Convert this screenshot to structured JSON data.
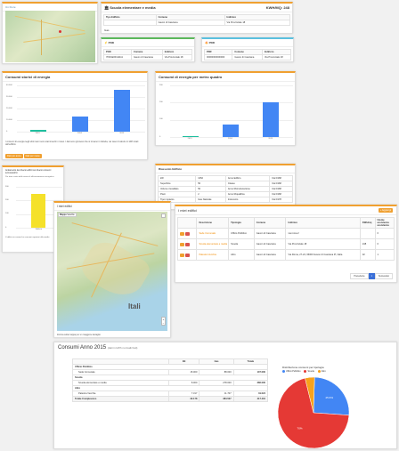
{
  "map_top": {
    "tabs": [
      "Un Fiore"
    ]
  },
  "school": {
    "title": "Scuola elementare e media",
    "kwh": "KWH/MQ: 248",
    "table_headers": [
      "Tipo Edificio",
      "Comune",
      "Indirizzo"
    ],
    "table_row": [
      "",
      "Gavon di Casciana",
      "Via Provinciale 18"
    ],
    "note": "Gas"
  },
  "pod": {
    "title": "POD",
    "headers": [
      "POD",
      "Comune",
      "Indirizzo"
    ],
    "row": [
      "IT001E00111111",
      "Gavon di Casciana",
      "Via Provinciale 18"
    ]
  },
  "pdr": {
    "title": "PDR",
    "headers": [
      "PDR",
      "Comune",
      "Indirizzo"
    ],
    "row": [
      "00000000000000",
      "Gavon di Casciana",
      "Via Provinciale 18"
    ]
  },
  "chart1": {
    "title": "Consumi storici di energia",
    "description": "I consumi di energia negli ultimi anni sono stati inseriti in rosso. I dati sono gli stessi che si trovano in bolletta, nel caso di calcolo in kWh totali dell'edificio.",
    "buttons": [
      "Dati per anno",
      "Dati per mese"
    ]
  },
  "chart2": {
    "title": "Consumi di energia per metro quadro"
  },
  "yellow_chart": {
    "title": "Andamento dei diversi edifici sui diversi consumi termoelettrici",
    "description": "Per dare conto delle azioni di efficientamento energetico.",
    "caption": "L'edificio in esame ha consumi superiori alla media"
  },
  "summary": {
    "title": "Riassunto Edificio",
    "rows": [
      [
        "kW",
        "1352",
        "Anno Edifico",
        "Dal 1968"
      ],
      [
        "Superficie",
        "50",
        "Classe",
        "Dal 1968"
      ],
      [
        "Volume riscaldato",
        "50",
        "Anno Ristrutturazione",
        "Dal 1968"
      ],
      [
        "Piani",
        "2",
        "Anno Riqualifica",
        "Dal 1968"
      ],
      [
        "Tipo impianto",
        "Gas Naturale",
        "Intervento",
        "Dal 1978"
      ]
    ]
  },
  "miei_map": {
    "title": "I miei edifici",
    "map_buttons": [
      "Mappa",
      "Satellite"
    ],
    "country_label": "Itali",
    "footer": "Zooma sulla mappa per un maggiore dettaglio"
  },
  "buildings": {
    "title": "I miei edifici",
    "add_button": "+ Aggiungi",
    "headers": [
      "",
      "Descrizione",
      "Tipologia",
      "Comune",
      "Indirizzo",
      "KWh/mq",
      "Utente assistenza assistenza"
    ],
    "rows": [
      [
        "Sede Comunale",
        "Ufficio Pubblico",
        "Gavon di Casciana",
        "via roma 2",
        "",
        "0"
      ],
      [
        "Scuola elementare e media",
        "Scuola",
        "Gavon di Casciana",
        "Via Provinciale 18",
        "248",
        "0"
      ],
      [
        "Palestra Vecchia",
        "Altro",
        "Gavon di Casciana",
        "Via Roma, 27-24, 66000 Gavon di Casciana PI, Italia",
        "32",
        "1"
      ]
    ],
    "pagination": [
      "Precedente",
      "1",
      "Successivo"
    ]
  },
  "consumi": {
    "title": "Consumi Anno 2015",
    "subtitle": "(dati in kWh normalizzati)",
    "headers": [
      "",
      "EE",
      "Gas",
      "Totale"
    ],
    "groups": [
      {
        "name": "Ufficio Pubblico",
        "rows": [
          [
            "Sede Comunale",
            "15.000",
            "88.000",
            "107.000"
          ]
        ]
      },
      {
        "name": "Scuola",
        "rows": [
          [
            "Scuola elementare e media",
            "8.000",
            "278.000",
            "286.000"
          ]
        ]
      },
      {
        "name": "Altro",
        "rows": [
          [
            "Palestra Vecchia",
            "7.317",
            "11.707",
            "19.024"
          ]
        ]
      }
    ],
    "total": [
      "Totale Complessivo",
      "22.178",
      "384.527",
      "417.410"
    ]
  },
  "pie": {
    "title": "Distribuzione consumi per tipologia",
    "legend": [
      "Ufficio Pubblico",
      "Scuola",
      "Altro"
    ],
    "colors": [
      "#4286f4",
      "#e53935",
      "#f7a21b"
    ]
  },
  "chart_data": [
    {
      "type": "bar",
      "title": "Consumi storici di energia",
      "categories": [
        "2013",
        "2014",
        "2015"
      ],
      "values": [
        1500,
        15000,
        41000
      ],
      "ylim": [
        0,
        45000
      ],
      "yticks": [
        "40.000",
        "30.000",
        "20.000",
        "10.000",
        "0"
      ],
      "colors": [
        "#1fbf9f",
        "#4286f4",
        "#4286f4"
      ]
    },
    {
      "type": "bar",
      "title": "Consumi di energia per metro quadro",
      "categories": [
        "2013",
        "2014",
        "2015"
      ],
      "values": [
        4,
        75,
        200
      ],
      "ylim": [
        0,
        300
      ],
      "yticks": [
        "300",
        "200",
        "100",
        "0"
      ],
      "colors": [
        "#1fbf9f",
        "#4286f4",
        "#4286f4"
      ]
    },
    {
      "type": "bar",
      "title": "Andamento dei diversi edifici",
      "categories": [
        "Edificio"
      ],
      "values": [
        250
      ],
      "ylim": [
        0,
        300
      ],
      "yticks": [
        "300",
        "200",
        "100",
        "0"
      ],
      "colors": [
        "#f5e12a"
      ]
    },
    {
      "type": "pie",
      "title": "Distribuzione consumi per tipologia",
      "labels": [
        "Ufficio Pubblico",
        "Scuola",
        "Altro"
      ],
      "values": [
        25.6,
        70.1,
        4.3
      ],
      "slice_labels": [
        "25.6%",
        "70%",
        ""
      ],
      "colors": [
        "#4286f4",
        "#e53935",
        "#f7a21b"
      ]
    }
  ]
}
